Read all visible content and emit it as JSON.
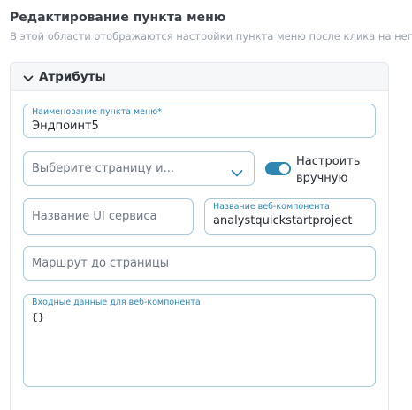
{
  "header": {
    "title": "Редактирование пункта меню",
    "subtitle": "В этой области отображаются настройки пункта меню после клика на него"
  },
  "panel": {
    "title": "Атрибуты",
    "collapse_icon": "chevron-up-icon"
  },
  "fields": {
    "menu_item_name": {
      "label": "Наименование пункта меню*",
      "value": "Эндпоинт5"
    },
    "page_select": {
      "placeholder": "Выберите страницу и...",
      "icon": "chevron-down-icon"
    },
    "manual_toggle": {
      "label": "Настроить вручную",
      "state": "on"
    },
    "ui_service_name": {
      "placeholder": "Название UI сервиса"
    },
    "web_component_name": {
      "label": "Название веб-компонента",
      "value": "analystquickstartproject"
    },
    "page_route": {
      "placeholder": "Маршрут до страницы"
    },
    "web_component_input": {
      "label": "Входные данные для веб-компонента",
      "value": "{}"
    }
  },
  "colors": {
    "accent": "#2f86b3",
    "field_border": "#a9c7d7",
    "panel_header_bg": "#f6f7f9"
  }
}
